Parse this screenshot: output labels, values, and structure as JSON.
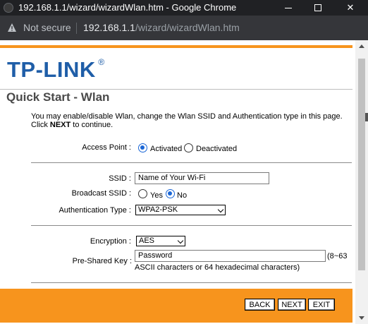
{
  "browser": {
    "window_title": "192.168.1.1/wizard/wizardWlan.htm - Google Chrome",
    "security_text": "Not secure",
    "url_host": "192.168.1.1",
    "url_path": "/wizard/wizardWlan.htm"
  },
  "header": {
    "logo_text": "TP-LINK",
    "logo_mark": "®",
    "page_title": "Quick Start - Wlan"
  },
  "intro": {
    "line1": "You may enable/disable Wlan, change the Wlan SSID and Authentication type in this page.",
    "line2_prefix": "Click ",
    "line2_bold": "NEXT",
    "line2_suffix": " to continue."
  },
  "form": {
    "access_point": {
      "label": "Access Point :",
      "options": [
        "Activated",
        "Deactivated"
      ],
      "selected": "Activated"
    },
    "ssid": {
      "label": "SSID :",
      "value": "Name of Your Wi-Fi"
    },
    "broadcast_ssid": {
      "label": "Broadcast SSID :",
      "options": [
        "Yes",
        "No"
      ],
      "selected": "No"
    },
    "auth_type": {
      "label": "Authentication Type :",
      "value": "WPA2-PSK"
    },
    "encryption": {
      "label": "Encryption :",
      "value": "AES"
    },
    "psk": {
      "label": "Pre-Shared Key :",
      "value": "Password",
      "hint_inline": "(8~63",
      "hint_line2": "ASCII characters or 64 hexadecimal characters)"
    }
  },
  "buttons": {
    "back": "BACK",
    "next": "NEXT",
    "exit": "EXIT"
  },
  "colors": {
    "accent_orange": "#f7941d",
    "logo_blue": "#1f5ea8",
    "chrome_dark": "#202124"
  }
}
